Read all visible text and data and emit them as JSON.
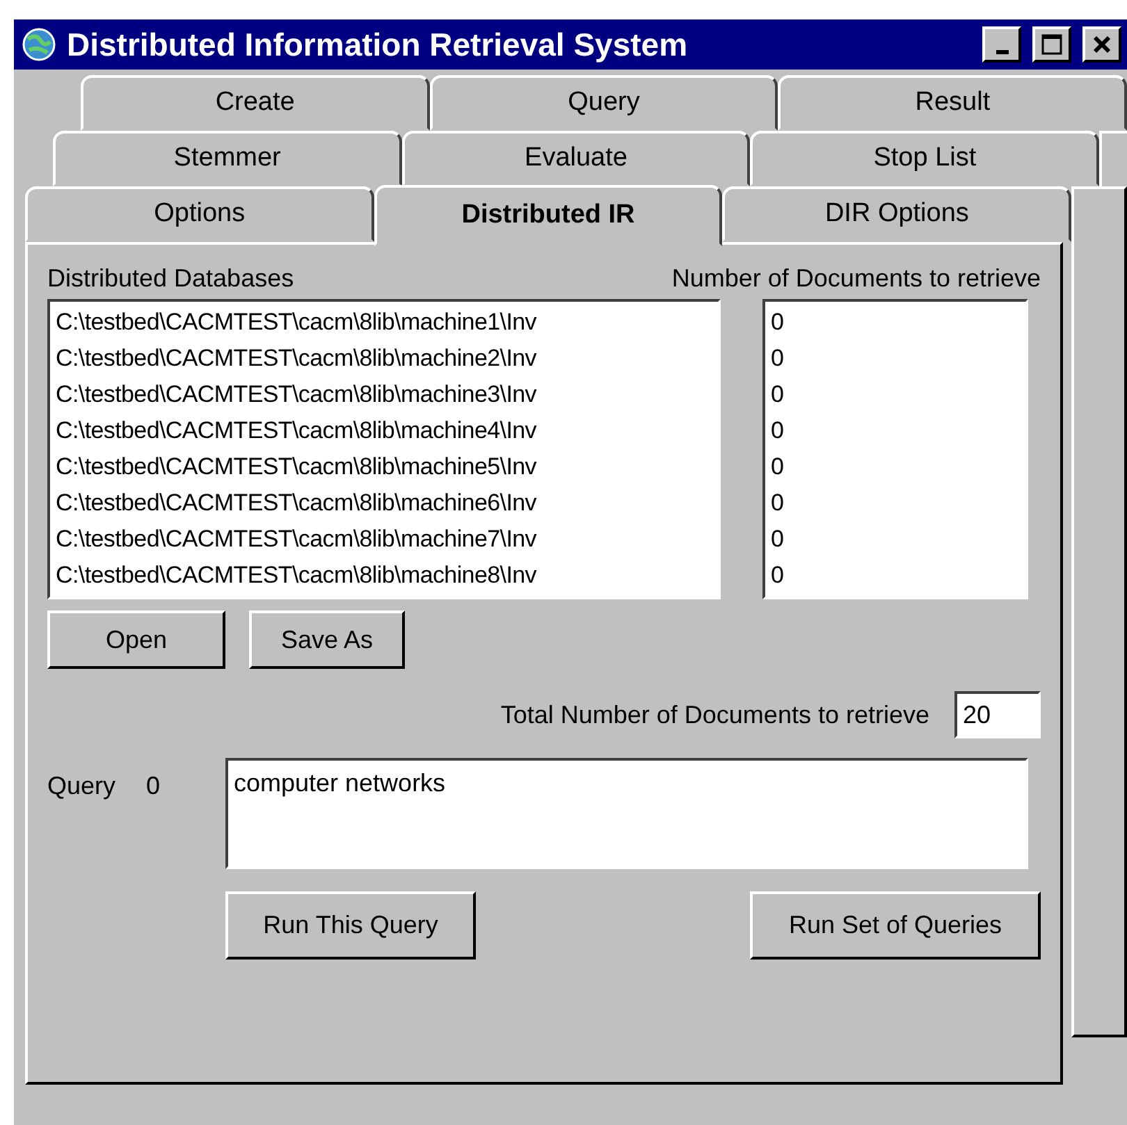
{
  "window": {
    "title": "Distributed Information Retrieval System"
  },
  "tab_rows": [
    [
      {
        "label": "Create",
        "selected": false
      },
      {
        "label": "Query",
        "selected": false
      },
      {
        "label": "Result",
        "selected": false
      }
    ],
    [
      {
        "label": "Stemmer",
        "selected": false
      },
      {
        "label": "Evaluate",
        "selected": false
      },
      {
        "label": "Stop List",
        "selected": false
      }
    ],
    [
      {
        "label": "Options",
        "selected": false
      },
      {
        "label": "Distributed IR",
        "selected": true
      },
      {
        "label": "DIR Options",
        "selected": false
      }
    ]
  ],
  "databases": {
    "label": "Distributed Databases",
    "items": [
      "C:\\testbed\\CACMTEST\\cacm\\8lib\\machine1\\Inv",
      "C:\\testbed\\CACMTEST\\cacm\\8lib\\machine2\\Inv",
      "C:\\testbed\\CACMTEST\\cacm\\8lib\\machine3\\Inv",
      "C:\\testbed\\CACMTEST\\cacm\\8lib\\machine4\\Inv",
      "C:\\testbed\\CACMTEST\\cacm\\8lib\\machine5\\Inv",
      "C:\\testbed\\CACMTEST\\cacm\\8lib\\machine6\\Inv",
      "C:\\testbed\\CACMTEST\\cacm\\8lib\\machine7\\Inv",
      "C:\\testbed\\CACMTEST\\cacm\\8lib\\machine8\\Inv"
    ]
  },
  "documents": {
    "label": "Number of Documents to retrieve",
    "items": [
      "0",
      "0",
      "0",
      "0",
      "0",
      "0",
      "0",
      "0"
    ]
  },
  "list_buttons": [
    "Open",
    "Save As"
  ],
  "total": {
    "label": "Total Number of Documents to retrieve",
    "value": "20"
  },
  "query": {
    "label": "Query",
    "number": "0",
    "value": "computer networks"
  },
  "query_buttons": [
    "Run This Query",
    "Run Set of Queries"
  ]
}
